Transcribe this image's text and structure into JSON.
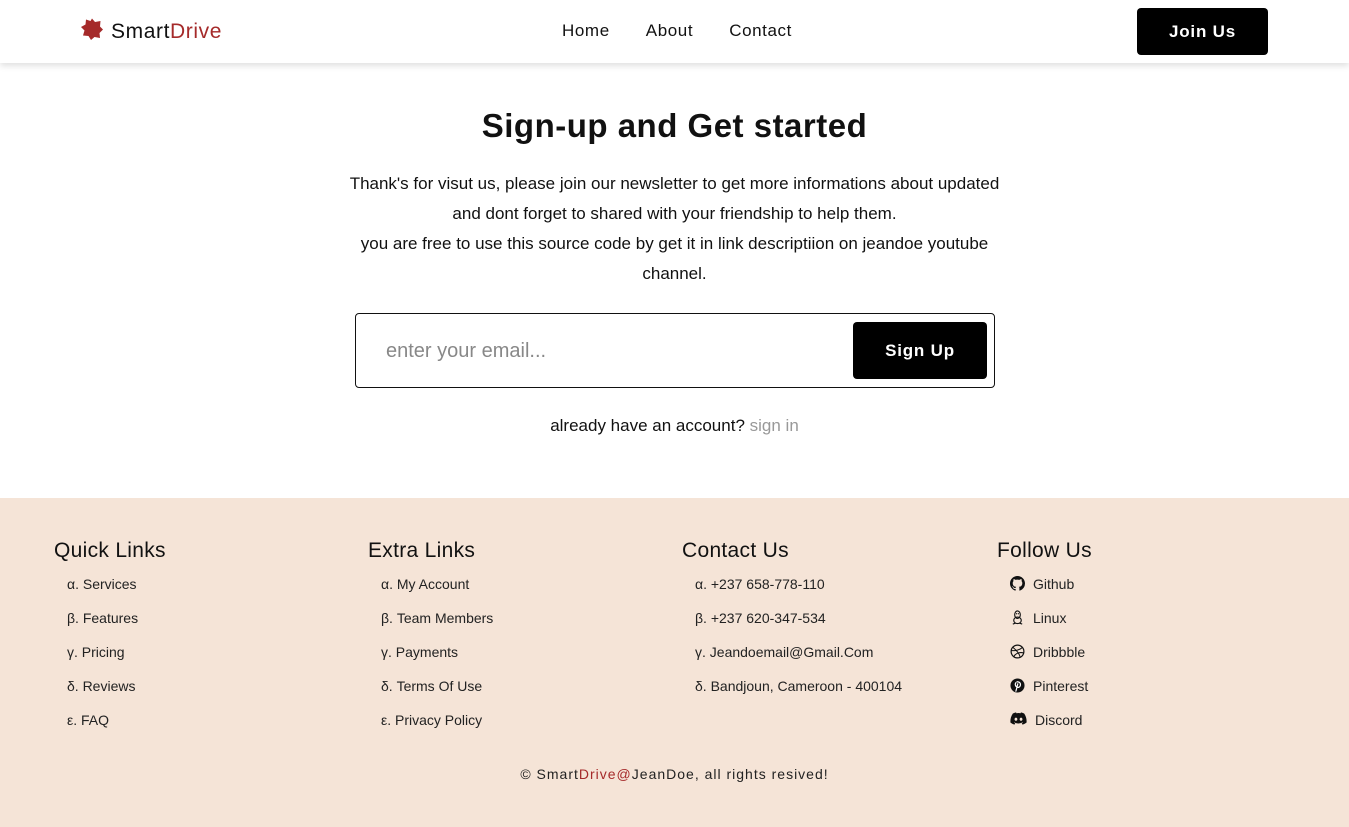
{
  "header": {
    "logo_prefix": "Smart",
    "logo_accent": "Drive",
    "logo_icon": "gear-blob-icon",
    "nav": [
      "Home",
      "About",
      "Contact"
    ],
    "join_label": "Join Us"
  },
  "main": {
    "title": "Sign-up and Get started",
    "desc_line1": "Thank's for visut us, please join our newsletter to get more informations about updated and dont forget to shared with your friendship to help them.",
    "desc_line2": "you are free to use this source code by get it in link descriptiion on jeandoe youtube channel.",
    "email_placeholder": "enter your email...",
    "signup_label": "Sign Up",
    "account_text": "already have an account?",
    "signin_label": "sign in"
  },
  "footer": {
    "quick_links": {
      "heading": "Quick Links",
      "items": [
        "α. Services",
        "β. Features",
        "γ. Pricing",
        "δ. Reviews",
        "ε. FAQ"
      ]
    },
    "extra_links": {
      "heading": "Extra Links",
      "items": [
        "α. My Account",
        "β. Team Members",
        "γ. Payments",
        "δ. Terms Of Use",
        "ε. Privacy Policy"
      ]
    },
    "contact": {
      "heading": "Contact Us",
      "items": [
        "α. +237 658-778-110",
        "β. +237 620-347-534",
        "γ. Jeandoemail@Gmail.Com",
        "δ. Bandjoun, Cameroon - 400104"
      ]
    },
    "follow": {
      "heading": "Follow Us",
      "items": [
        {
          "label": "Github",
          "icon": "github-icon"
        },
        {
          "label": "Linux",
          "icon": "linux-icon"
        },
        {
          "label": "Dribbble",
          "icon": "dribbble-icon"
        },
        {
          "label": "Pinterest",
          "icon": "pinterest-icon"
        },
        {
          "label": "Discord",
          "icon": "discord-icon"
        }
      ]
    },
    "copyright_prefix": "© Smart",
    "copyright_accent": "Drive@",
    "copyright_suffix": "JeanDoe, all rights resived!"
  },
  "colors": {
    "accent": "#a52a2a",
    "footer_bg": "#f5e4d7",
    "button_bg": "#000000"
  }
}
